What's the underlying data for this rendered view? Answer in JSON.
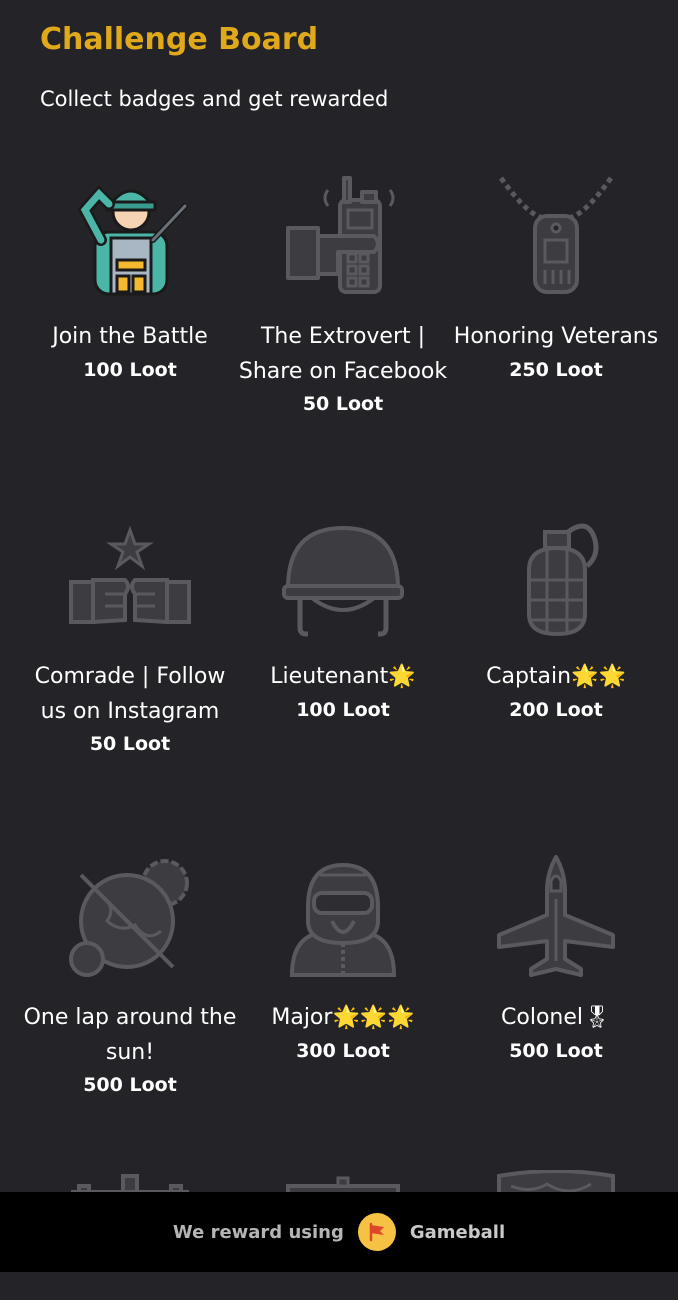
{
  "header": {
    "title": "Challenge Board",
    "subtitle": "Collect badges and get rewarded"
  },
  "badges": [
    {
      "name": "Join the Battle",
      "loot": "100 Loot",
      "icon": "saluting-soldier-icon",
      "active": true
    },
    {
      "name": "The Extrovert | Share on Facebook",
      "loot": "50 Loot",
      "icon": "walkie-talkie-icon",
      "active": false
    },
    {
      "name": "Honoring Veterans",
      "loot": "250 Loot",
      "icon": "dog-tag-icon",
      "active": false
    },
    {
      "name": "Comrade | Follow us on Instagram",
      "loot": "50 Loot",
      "icon": "fist-bump-icon",
      "active": false
    },
    {
      "name": "Lieutenant🌟",
      "loot": "100 Loot",
      "icon": "helmet-icon",
      "active": false
    },
    {
      "name": "Captain🌟🌟",
      "loot": "200 Loot",
      "icon": "grenade-icon",
      "active": false
    },
    {
      "name": "One lap around the sun!",
      "loot": "500 Loot",
      "icon": "globe-icon",
      "active": false
    },
    {
      "name": "Major🌟🌟🌟",
      "loot": "300 Loot",
      "icon": "pilot-icon",
      "active": false
    },
    {
      "name": "Colonel🎖",
      "loot": "500 Loot",
      "icon": "fighter-jet-icon",
      "active": false
    }
  ],
  "footer": {
    "text": "We reward using",
    "brand": "Gameball"
  },
  "colors": {
    "accent": "#e0a81b",
    "background": "#242327",
    "footer_bg": "#000000",
    "locked_icon": "#3d3c41",
    "locked_stroke": "#5a595e"
  }
}
